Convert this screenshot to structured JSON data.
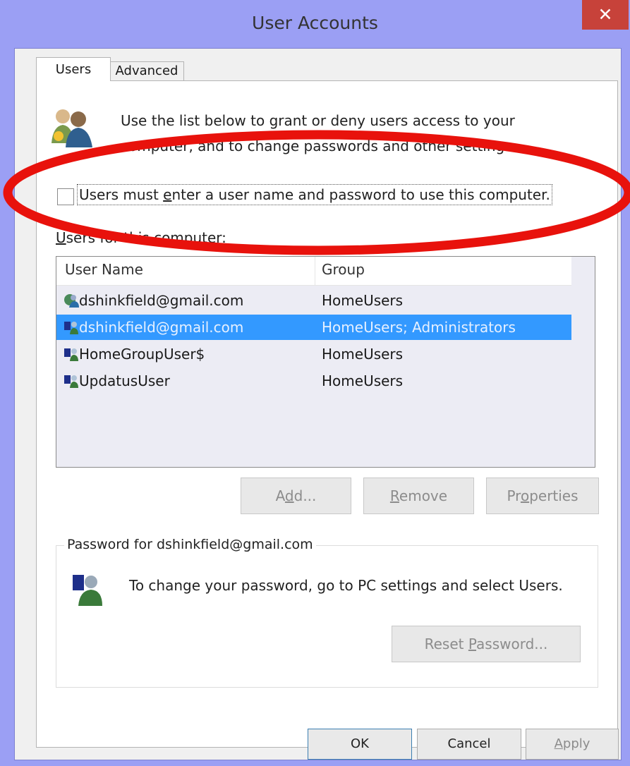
{
  "window": {
    "title": "User Accounts",
    "close_glyph": "✕"
  },
  "tabs": [
    {
      "label": "Users",
      "active": true
    },
    {
      "label": "Advanced",
      "active": false
    }
  ],
  "intro_text": "Use the list below to grant or deny users access to your computer, and to change passwords and other settings.",
  "checkbox": {
    "label_pre": "Users must ",
    "label_accel": "e",
    "label_post": "nter a user name and password to use this computer.",
    "checked": false
  },
  "list": {
    "label_accel": "U",
    "label_rest": "sers for this computer:",
    "columns": [
      "User Name",
      "Group"
    ],
    "rows": [
      {
        "name": "dshinkfield@gmail.com",
        "group": "HomeUsers",
        "icon": "online-user-icon",
        "selected": false
      },
      {
        "name": "dshinkfield@gmail.com",
        "group": "HomeUsers; Administrators",
        "icon": "user-icon",
        "selected": true
      },
      {
        "name": "HomeGroupUser$",
        "group": "HomeUsers",
        "icon": "user-icon",
        "selected": false
      },
      {
        "name": "UpdatusUser",
        "group": "HomeUsers",
        "icon": "user-icon",
        "selected": false
      }
    ]
  },
  "buttons": {
    "add": {
      "pre": "A",
      "accel": "d",
      "post": "d..."
    },
    "remove": {
      "pre": "",
      "accel": "R",
      "post": "emove"
    },
    "properties": {
      "pre": "Pr",
      "accel": "o",
      "post": "perties"
    }
  },
  "password_group": {
    "legend": "Password for dshinkfield@gmail.com",
    "text": "To change your password, go to PC settings and select Users.",
    "reset": {
      "pre": "Reset ",
      "accel": "P",
      "post": "assword..."
    }
  },
  "footer": {
    "ok": "OK",
    "cancel": "Cancel",
    "apply_accel": "A",
    "apply_rest": "pply"
  },
  "colors": {
    "frame": "#9b9ff4",
    "close": "#c7423a",
    "selection": "#3399ff",
    "annotation": "#e8120c"
  }
}
